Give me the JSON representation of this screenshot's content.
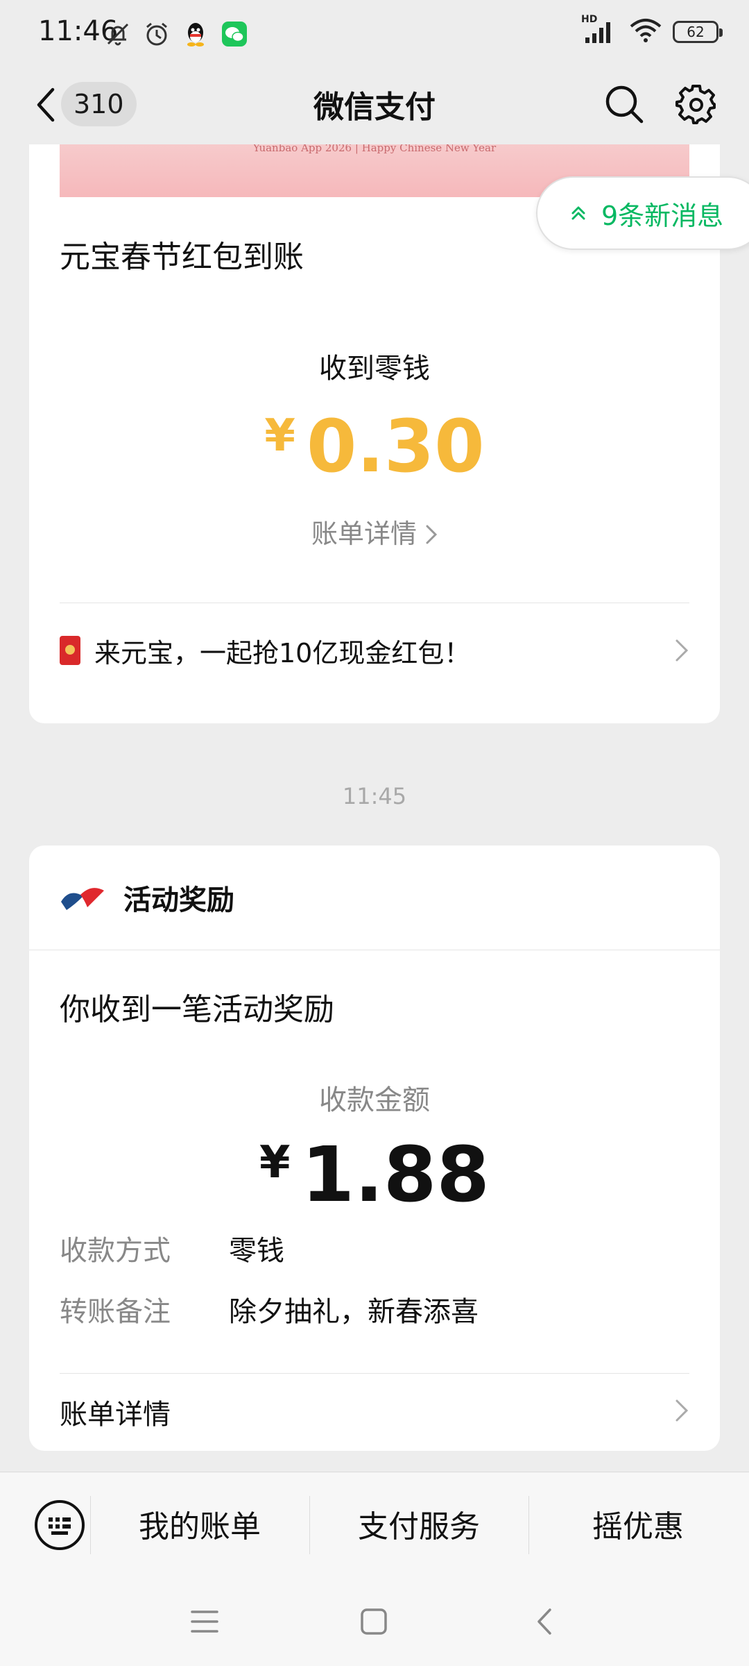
{
  "status_bar": {
    "time": "11:46",
    "hd_label": "HD",
    "battery": "62",
    "icons": [
      "bell-muted-icon",
      "alarm-icon",
      "qq-icon",
      "wechat-icon",
      "signal-icon",
      "wifi-icon",
      "battery-icon"
    ]
  },
  "nav": {
    "unread_count": "310",
    "title": "微信支付"
  },
  "new_messages": {
    "label": "9条新消息"
  },
  "message1": {
    "banner_text": "Yuanbao App 2026 | Happy Chinese New Year",
    "title": "元宝春节红包到账",
    "received_label": "收到零钱",
    "currency": "¥",
    "amount": "0.30",
    "detail_link": "账单详情",
    "promo_text": "来元宝，一起抢10亿现金红包！"
  },
  "timestamp": "11:45",
  "message2": {
    "source": "活动奖励",
    "title": "你收到一笔活动奖励",
    "amount_label": "收款金额",
    "currency": "¥",
    "amount": "1.88",
    "details": [
      {
        "key": "收款方式",
        "value": "零钱"
      },
      {
        "key": "转账备注",
        "value": "除夕抽礼，新春添喜"
      }
    ],
    "bill_detail": "账单详情"
  },
  "bottom_menu": {
    "items": [
      "我的账单",
      "支付服务",
      "摇优惠"
    ]
  },
  "colors": {
    "background": "#ededed",
    "accent_green": "#07b862",
    "amount_yellow": "#f6b93b"
  }
}
